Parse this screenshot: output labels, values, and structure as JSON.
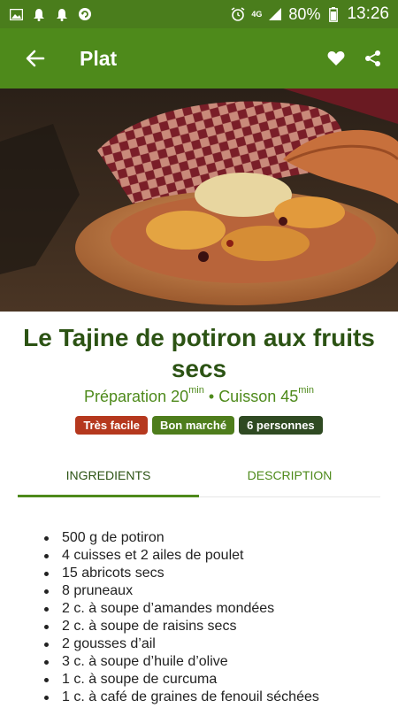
{
  "status_bar": {
    "battery": "80%",
    "network": "4G",
    "time": "13:26",
    "icons": [
      "image-icon",
      "alarm-bell-icon",
      "alarm-bell-icon",
      "sync-icon",
      "alarm-clock-icon",
      "signal-icon",
      "battery-icon"
    ]
  },
  "app_bar": {
    "title": "Plat",
    "back_icon": "arrow-back-icon",
    "actions": [
      "heart-icon",
      "share-icon"
    ],
    "color": "#4e8a1b"
  },
  "recipe": {
    "title": "Le Tajine de potiron aux fruits secs",
    "prep_label": "Préparation 20",
    "cook_label": "Cuisson 45",
    "unit": "min",
    "separator": "•",
    "badges": [
      {
        "label": "Très facile",
        "color": "#b5381e"
      },
      {
        "label": "Bon marché",
        "color": "#4e7d1c"
      },
      {
        "label": "6 personnes",
        "color": "#2f4a22"
      }
    ]
  },
  "tabs": [
    {
      "label": "INGREDIENTS",
      "active": true
    },
    {
      "label": "DESCRIPTION",
      "active": false
    }
  ],
  "ingredients": [
    "500 g de potiron",
    "4 cuisses et 2 ailes de poulet",
    "15 abricots secs",
    "8 pruneaux",
    "2 c. à soupe d’amandes mondées",
    "2 c. à soupe de raisins secs",
    "2 gousses d’ail",
    "3 c. à soupe d’huile d’olive",
    "1 c. à soupe de curcuma",
    "1 c. à café de graines de fenouil séchées"
  ]
}
